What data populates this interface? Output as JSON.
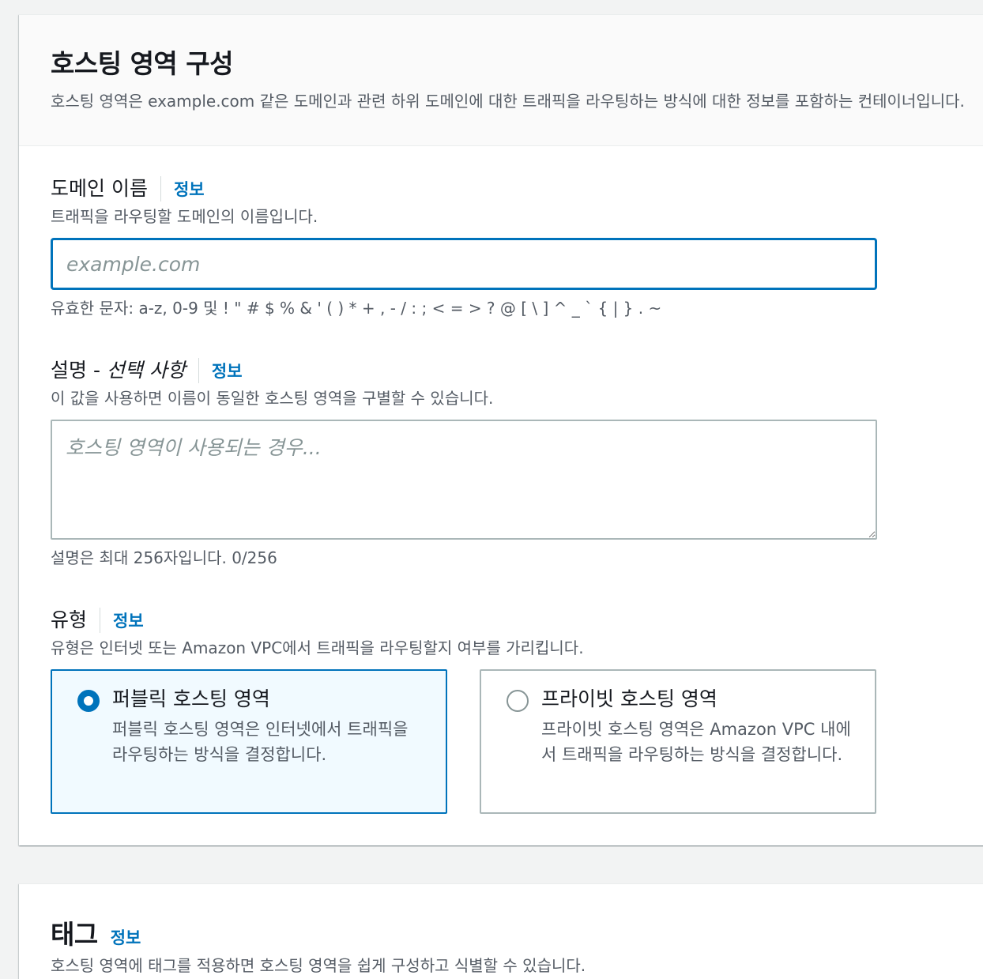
{
  "hosted_zone_config": {
    "title": "호스팅 영역 구성",
    "description": "호스팅 영역은 example.com 같은 도메인과 관련 하위 도메인에 대한 트래픽을 라우팅하는 방식에 대한 정보를 포함하는 컨테이너입니다."
  },
  "domain_name": {
    "label": "도메인 이름",
    "info": "정보",
    "description": "트래픽을 라우팅할 도메인의 이름입니다.",
    "value": "",
    "placeholder": "example.com",
    "constraint": "유효한 문자: a-z, 0-9 및 ! \" # $ % & ' ( ) * + , - / : ; < = > ? @ [ \\ ] ^ _ ` { | } . ~"
  },
  "description_field": {
    "label": "설명 - ",
    "label_optional": "선택 사항",
    "info": "정보",
    "description": "이 값을 사용하면 이름이 동일한 호스팅 영역을 구별할 수 있습니다.",
    "value": "",
    "placeholder": "호스팅 영역이 사용되는 경우...",
    "constraint": "설명은 최대 256자입니다. 0/256"
  },
  "type": {
    "label": "유형",
    "info": "정보",
    "description": "유형은 인터넷 또는 Amazon VPC에서 트래픽을 라우팅할지 여부를 가리킵니다.",
    "options": [
      {
        "title": "퍼블릭 호스팅 영역",
        "description": "퍼블릭 호스팅 영역은 인터넷에서 트래픽을 라우팅하는 방식을 결정합니다.",
        "selected": true
      },
      {
        "title": "프라이빗 호스팅 영역",
        "description": "프라이빗 호스팅 영역은 Amazon VPC 내에서 트래픽을 라우팅하는 방식을 결정합니다.",
        "selected": false
      }
    ]
  },
  "tags": {
    "title": "태그",
    "info": "정보",
    "description": "호스팅 영역에 태그를 적용하면 호스팅 영역을 쉽게 구성하고 식별할 수 있습니다."
  },
  "colors": {
    "accent": "#0073bb",
    "selected_tile_bg": "#f1faff"
  }
}
